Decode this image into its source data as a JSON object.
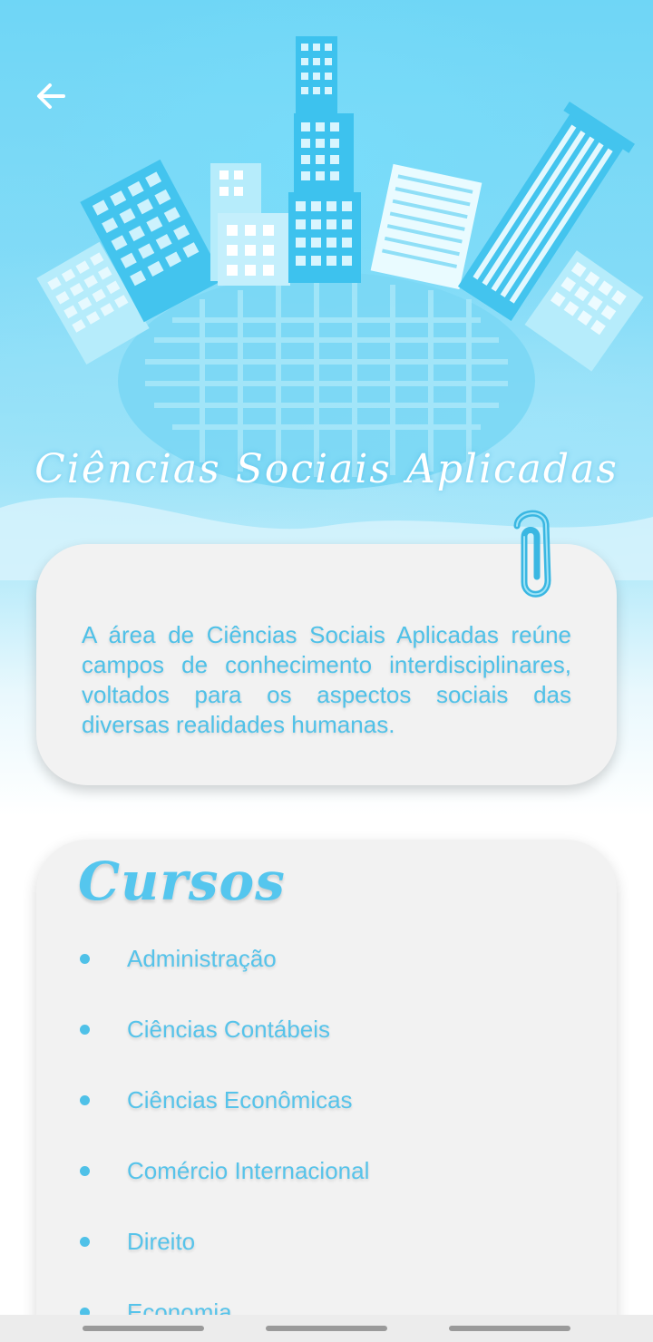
{
  "hero": {
    "title": "Ciências Sociais Aplicadas"
  },
  "intro": {
    "text": "A área de Ciências Sociais Aplicadas reúne campos de conhecimento interdisci­plinares, voltados para os aspectos sociais das diversas realidades humanas."
  },
  "courses": {
    "title": "Cursos",
    "items": [
      {
        "label": "Administração"
      },
      {
        "label": "Ciências Contábeis"
      },
      {
        "label": "Ciências Econômicas"
      },
      {
        "label": "Comércio Internacional"
      },
      {
        "label": "Direito"
      },
      {
        "label": "Economia"
      }
    ]
  },
  "icons": {
    "back": "arrow-left-icon",
    "clip": "paperclip-icon",
    "bullet": "bullet-dot-icon"
  },
  "colors": {
    "accent": "#4fc1e8",
    "card": "#f2f2f2",
    "hero_sky": "#6fd6f6"
  }
}
